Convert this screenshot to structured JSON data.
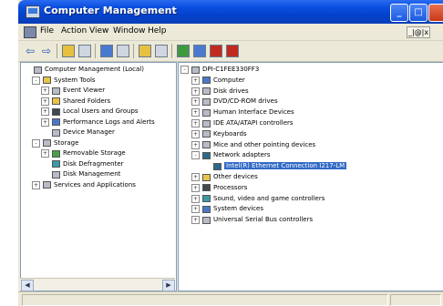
{
  "window": {
    "title": "Computer Management"
  },
  "menu": [
    "File",
    "Action",
    "View",
    "Window",
    "Help"
  ],
  "mdi": {
    "label": "_|@|x"
  },
  "left_tree": [
    {
      "label": "Computer Management (Local)",
      "icon": "computer-management-icon",
      "indent": 0,
      "toggle": "",
      "color": "gray"
    },
    {
      "label": "System Tools",
      "icon": "system-tools-icon",
      "indent": 1,
      "toggle": "-",
      "color": "yellow"
    },
    {
      "label": "Event Viewer",
      "icon": "event-viewer-icon",
      "indent": 2,
      "toggle": "+",
      "color": "gray"
    },
    {
      "label": "Shared Folders",
      "icon": "shared-folders-icon",
      "indent": 2,
      "toggle": "+",
      "color": "yellow"
    },
    {
      "label": "Local Users and Groups",
      "icon": "users-icon",
      "indent": 2,
      "toggle": "+",
      "color": "dark"
    },
    {
      "label": "Performance Logs and Alerts",
      "icon": "performance-icon",
      "indent": 2,
      "toggle": "+",
      "color": "blue"
    },
    {
      "label": "Device Manager",
      "icon": "device-manager-icon",
      "indent": 2,
      "toggle": "",
      "color": "gray",
      "selected_soft": true
    },
    {
      "label": "Storage",
      "icon": "storage-icon",
      "indent": 1,
      "toggle": "-",
      "color": "gray"
    },
    {
      "label": "Removable Storage",
      "icon": "removable-storage-icon",
      "indent": 2,
      "toggle": "+",
      "color": "green"
    },
    {
      "label": "Disk Defragmenter",
      "icon": "defrag-icon",
      "indent": 2,
      "toggle": "",
      "color": "teal"
    },
    {
      "label": "Disk Management",
      "icon": "disk-management-icon",
      "indent": 2,
      "toggle": "",
      "color": "gray"
    },
    {
      "label": "Services and Applications",
      "icon": "services-icon",
      "indent": 1,
      "toggle": "+",
      "color": "gray"
    }
  ],
  "right_tree": [
    {
      "label": "DPI-C1FEE330FF3",
      "icon": "computer-icon",
      "indent": 0,
      "toggle": "-",
      "color": "gray"
    },
    {
      "label": "Computer",
      "icon": "computer-icon",
      "indent": 1,
      "toggle": "+",
      "color": "blue"
    },
    {
      "label": "Disk drives",
      "icon": "disk-drive-icon",
      "indent": 1,
      "toggle": "+",
      "color": "gray"
    },
    {
      "label": "DVD/CD-ROM drives",
      "icon": "dvd-icon",
      "indent": 1,
      "toggle": "+",
      "color": "gray"
    },
    {
      "label": "Human Interface Devices",
      "icon": "hid-icon",
      "indent": 1,
      "toggle": "+",
      "color": "gray"
    },
    {
      "label": "IDE ATA/ATAPI controllers",
      "icon": "ide-icon",
      "indent": 1,
      "toggle": "+",
      "color": "gray"
    },
    {
      "label": "Keyboards",
      "icon": "keyboard-icon",
      "indent": 1,
      "toggle": "+",
      "color": "gray"
    },
    {
      "label": "Mice and other pointing devices",
      "icon": "mouse-icon",
      "indent": 1,
      "toggle": "+",
      "color": "gray"
    },
    {
      "label": "Network adapters",
      "icon": "network-icon",
      "indent": 1,
      "toggle": "-",
      "color": "net"
    },
    {
      "label": "Intel(R) Ethernet Connection I217-LM",
      "icon": "network-card-icon",
      "indent": 2,
      "toggle": "",
      "color": "net",
      "selected": true
    },
    {
      "label": "Other devices",
      "icon": "other-devices-icon",
      "indent": 1,
      "toggle": "+",
      "color": "yellow"
    },
    {
      "label": "Processors",
      "icon": "processor-icon",
      "indent": 1,
      "toggle": "+",
      "color": "dark"
    },
    {
      "label": "Sound, video and game controllers",
      "icon": "sound-icon",
      "indent": 1,
      "toggle": "+",
      "color": "teal"
    },
    {
      "label": "System devices",
      "icon": "system-devices-icon",
      "indent": 1,
      "toggle": "+",
      "color": "blue"
    },
    {
      "label": "Universal Serial Bus controllers",
      "icon": "usb-icon",
      "indent": 1,
      "toggle": "+",
      "color": "gray"
    }
  ]
}
